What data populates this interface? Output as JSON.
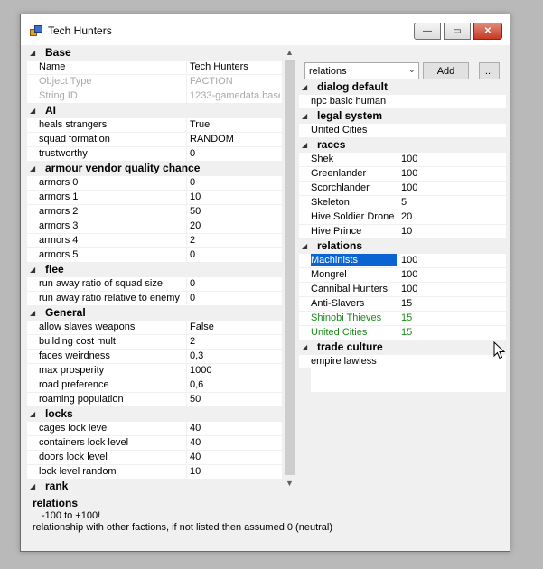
{
  "window": {
    "title": "Tech Hunters",
    "icons": {
      "app": "app-icon",
      "minimize": "minimize-icon",
      "maximize": "maximize-icon",
      "close": "close-icon"
    },
    "minimize_glyph": "—",
    "maximize_glyph": "▭",
    "close_glyph": "✕"
  },
  "left_grid": {
    "categories": [
      {
        "label": "Base",
        "rows": [
          {
            "name": "Name",
            "value": "Tech Hunters"
          },
          {
            "name": "Object Type",
            "value": "FACTION",
            "disabled": true
          },
          {
            "name": "String ID",
            "value": "1233-gamedata.base",
            "disabled": true
          }
        ]
      },
      {
        "label": "AI",
        "rows": [
          {
            "name": "heals strangers",
            "value": "True"
          },
          {
            "name": "squad formation",
            "value": "RANDOM"
          },
          {
            "name": "trustworthy",
            "value": "0"
          }
        ]
      },
      {
        "label": "armour vendor quality chance",
        "rows": [
          {
            "name": "armors 0",
            "value": "0"
          },
          {
            "name": "armors 1",
            "value": "10"
          },
          {
            "name": "armors 2",
            "value": "50"
          },
          {
            "name": "armors 3",
            "value": "20"
          },
          {
            "name": "armors 4",
            "value": "2"
          },
          {
            "name": "armors 5",
            "value": "0"
          }
        ]
      },
      {
        "label": "flee",
        "rows": [
          {
            "name": "run away ratio of squad size",
            "value": "0"
          },
          {
            "name": "run away ratio relative to enemy",
            "value": "0"
          }
        ]
      },
      {
        "label": "General",
        "rows": [
          {
            "name": "allow slaves weapons",
            "value": "False"
          },
          {
            "name": "building cost mult",
            "value": "2"
          },
          {
            "name": "faces weirdness",
            "value": "0,3"
          },
          {
            "name": "max prosperity",
            "value": "1000"
          },
          {
            "name": "road preference",
            "value": "0,6"
          },
          {
            "name": "roaming population",
            "value": "50"
          }
        ]
      },
      {
        "label": "locks",
        "rows": [
          {
            "name": "cages lock level",
            "value": "40"
          },
          {
            "name": "containers lock level",
            "value": "40"
          },
          {
            "name": "doors lock level",
            "value": "40"
          },
          {
            "name": "lock level random",
            "value": "10"
          }
        ]
      },
      {
        "label": "rank",
        "rows": []
      }
    ]
  },
  "scrollbar": {
    "up_glyph": "▲",
    "down_glyph": "▼",
    "up_icon": "chevron-up-icon",
    "down_icon": "chevron-down-icon"
  },
  "toolbar": {
    "combo_value": "relations",
    "combo_glyph": "⌄",
    "add_label": "Add",
    "more_label": "..."
  },
  "right_grid": {
    "categories": [
      {
        "label": "dialog default",
        "rows": [
          {
            "name": "npc basic human",
            "value": ""
          }
        ]
      },
      {
        "label": "legal system",
        "rows": [
          {
            "name": "United Cities",
            "value": ""
          }
        ]
      },
      {
        "label": "races",
        "rows": [
          {
            "name": "Shek",
            "value": "100"
          },
          {
            "name": "Greenlander",
            "value": "100"
          },
          {
            "name": "Scorchlander",
            "value": "100"
          },
          {
            "name": "Skeleton",
            "value": "5"
          },
          {
            "name": "Hive Soldier Drone",
            "value": "20"
          },
          {
            "name": "Hive Prince",
            "value": "10"
          }
        ]
      },
      {
        "label": "relations",
        "rows": [
          {
            "name": "Machinists",
            "value": "100",
            "selected": true
          },
          {
            "name": "Mongrel",
            "value": "100"
          },
          {
            "name": "Cannibal Hunters",
            "value": "100"
          },
          {
            "name": "Anti-Slavers",
            "value": "15"
          },
          {
            "name": "Shinobi Thieves",
            "value": "15",
            "green": true
          },
          {
            "name": "United Cities",
            "value": "15",
            "green": true
          }
        ]
      },
      {
        "label": "trade culture",
        "rows": [
          {
            "name": "empire lawless",
            "value": ""
          }
        ]
      }
    ]
  },
  "help": {
    "title": "relations",
    "range": "-100 to +100!",
    "description": "relationship with other factions, if not listed then assumed 0 (neutral)"
  },
  "colors": {
    "selection": "#0a64d2",
    "green_text": "#1b8a1b",
    "disabled_text": "#a9a9a9"
  },
  "cursor_icon": "mouse-cursor-icon",
  "collapse_icon": "collapse-triangle-icon",
  "collapse_glyph": "◢"
}
